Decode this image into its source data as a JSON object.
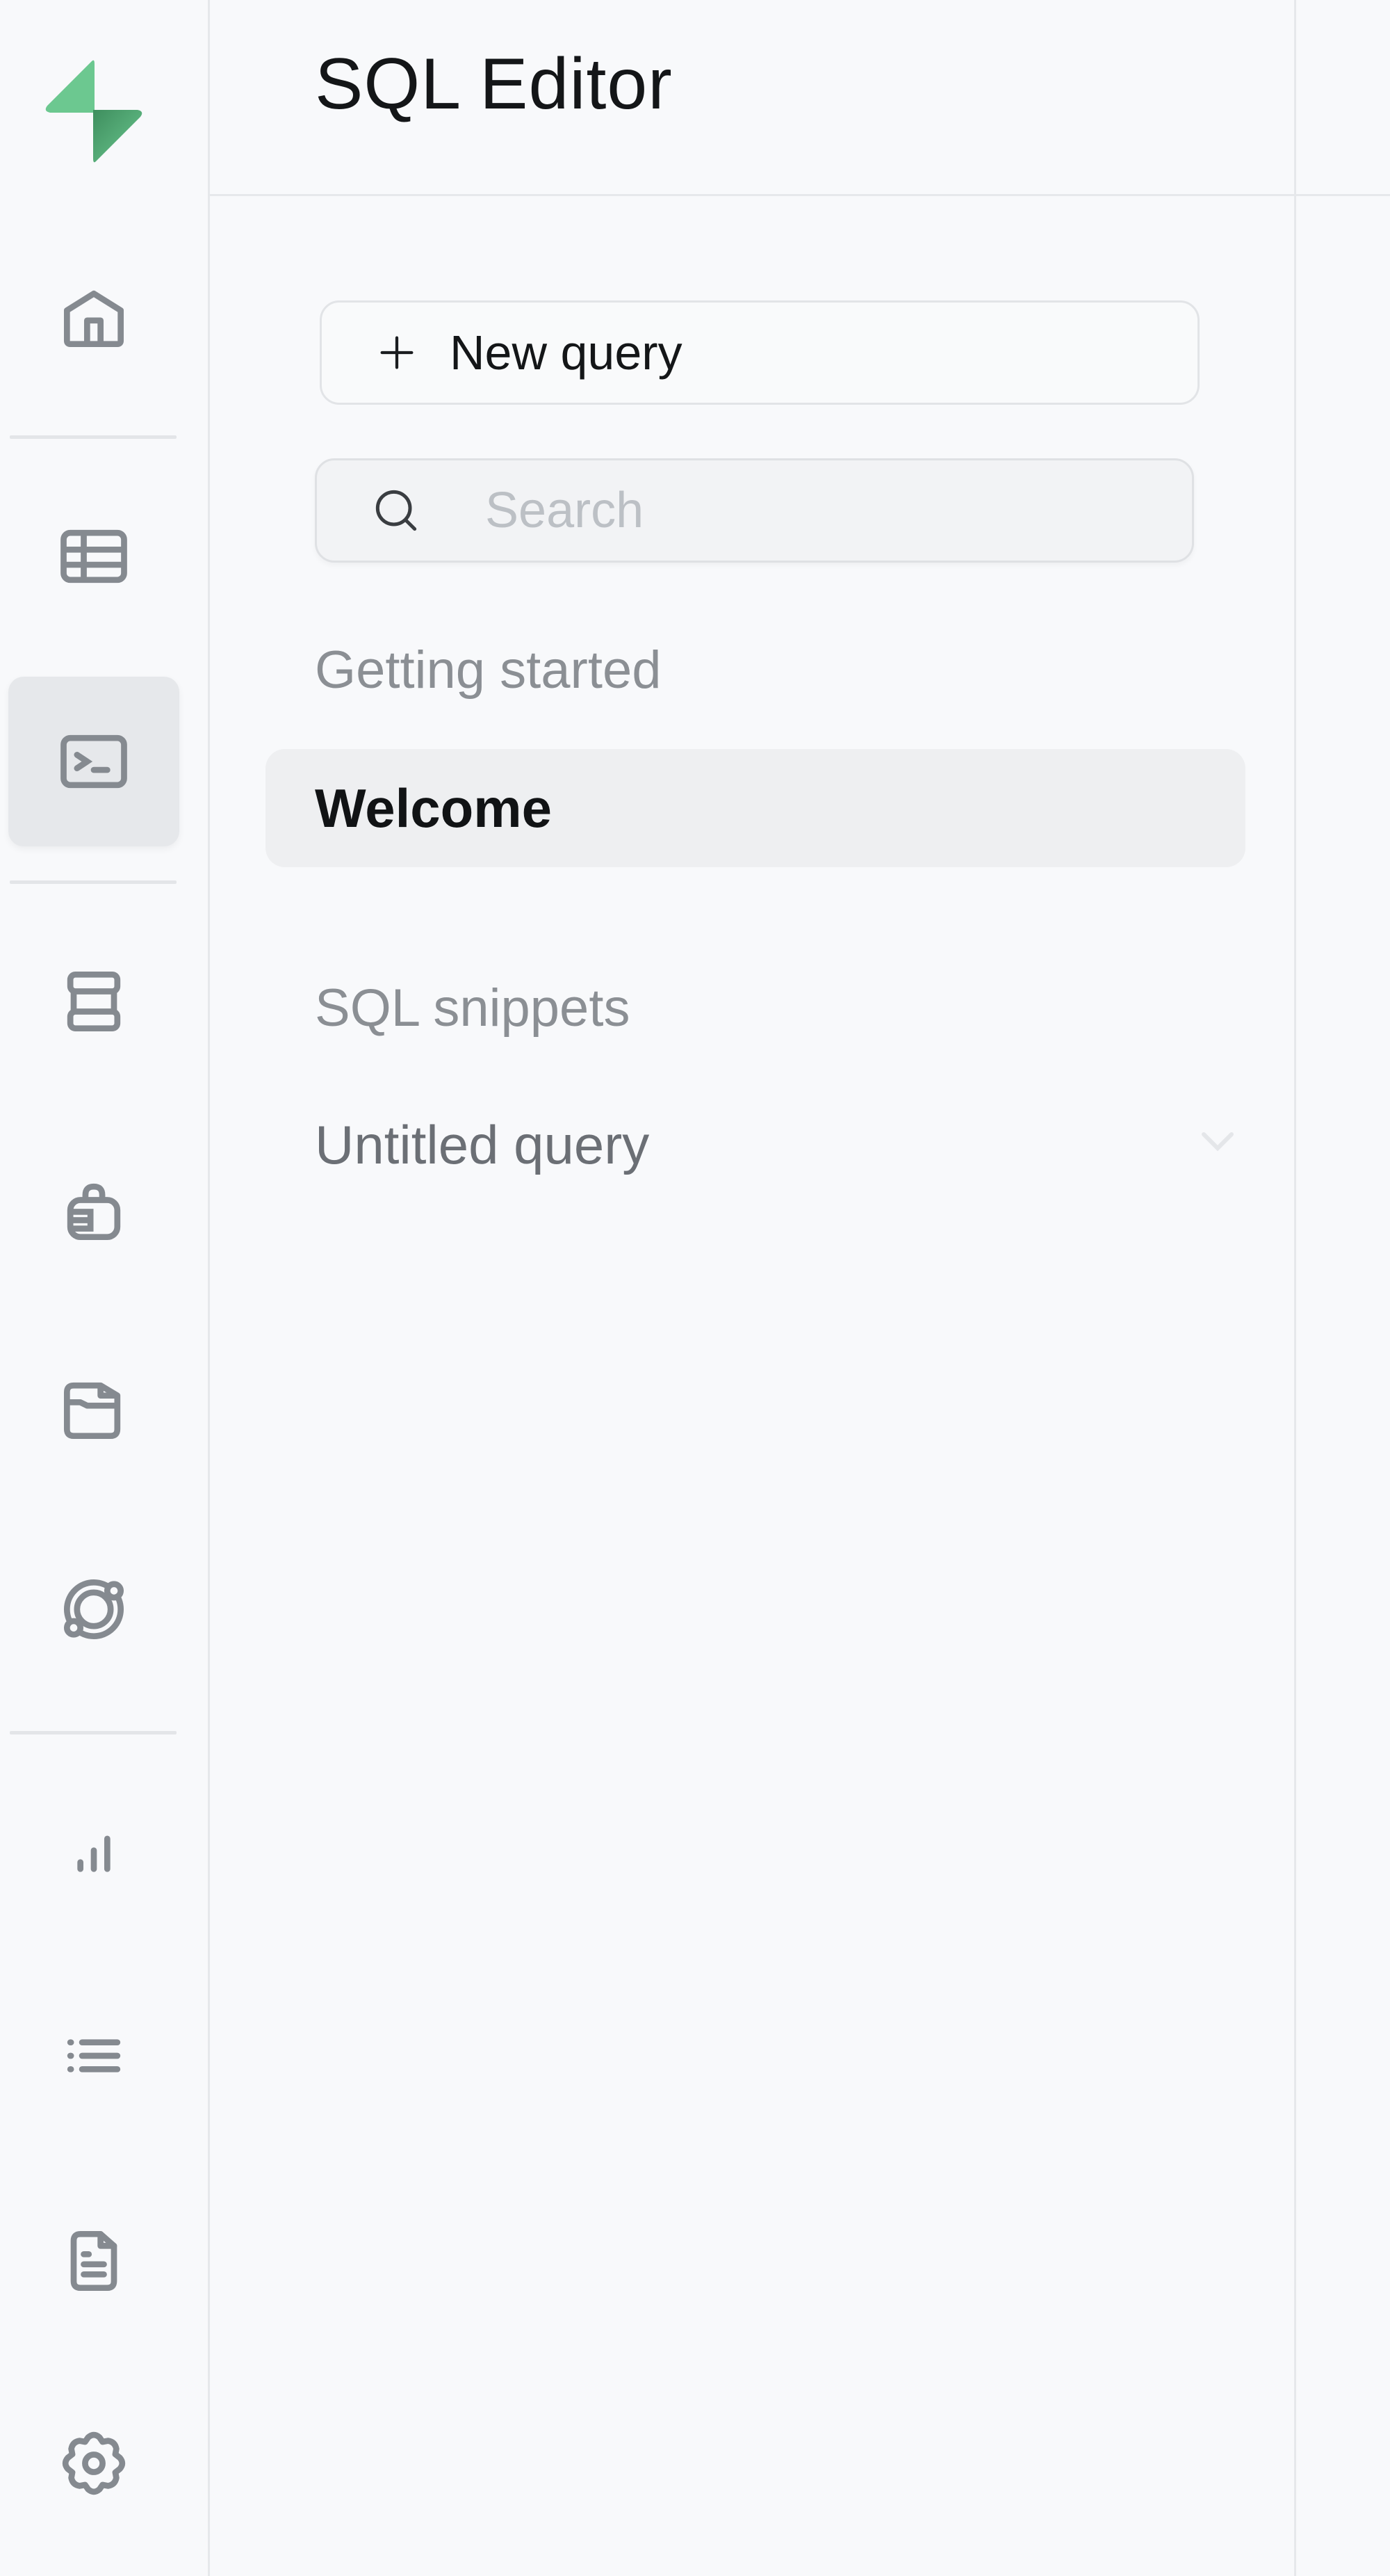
{
  "app": {
    "brand_icon": "supabase-logo-icon",
    "brand_colors": {
      "primary": "#6cc890",
      "dark": "#3e8e5e"
    }
  },
  "nav": {
    "items": [
      {
        "id": "home",
        "icon": "home-icon",
        "active": false
      },
      {
        "id": "table-editor",
        "icon": "table-icon",
        "active": false
      },
      {
        "id": "sql-editor",
        "icon": "terminal-icon",
        "active": true
      },
      {
        "id": "database",
        "icon": "database-icon",
        "active": false
      },
      {
        "id": "authentication",
        "icon": "lock-icon",
        "active": false
      },
      {
        "id": "storage",
        "icon": "folder-icon",
        "active": false
      },
      {
        "id": "realtime",
        "icon": "realtime-orbit-icon",
        "active": false
      },
      {
        "id": "reports",
        "icon": "bar-chart-icon",
        "active": false
      },
      {
        "id": "logs",
        "icon": "list-icon",
        "active": false
      },
      {
        "id": "api-docs",
        "icon": "document-icon",
        "active": false
      },
      {
        "id": "settings",
        "icon": "gear-icon",
        "active": false
      }
    ]
  },
  "panel": {
    "title": "SQL Editor",
    "new_query_label": "New query",
    "search": {
      "placeholder": "Search",
      "value": ""
    },
    "sections": [
      {
        "label": "Getting started",
        "items": [
          {
            "label": "Welcome",
            "active": true
          }
        ]
      },
      {
        "label": "SQL snippets",
        "items": [
          {
            "label": "Untitled query",
            "active": false,
            "has_chevron": true
          }
        ]
      }
    ]
  }
}
